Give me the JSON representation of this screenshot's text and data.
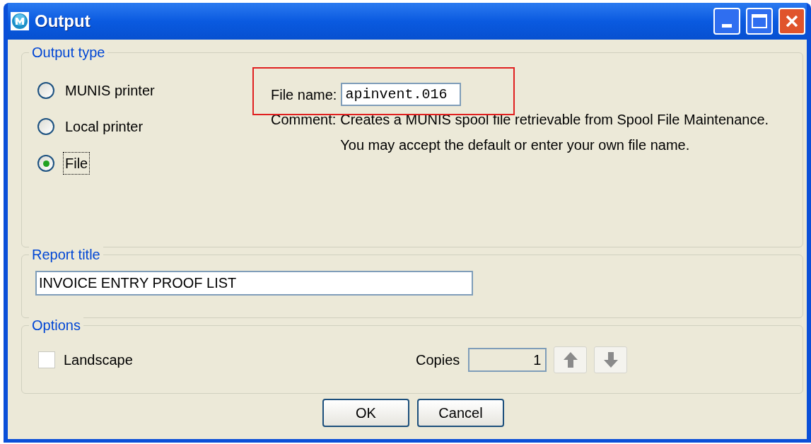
{
  "window": {
    "title": "Output"
  },
  "output_type": {
    "label": "Output type",
    "options": [
      {
        "label": "MUNIS printer",
        "selected": false
      },
      {
        "label": "Local printer",
        "selected": false
      },
      {
        "label": "File",
        "selected": true
      }
    ],
    "file_name": {
      "label": "File name:",
      "value": "apinvent.016"
    },
    "comment": {
      "label": "Comment:",
      "lines": [
        "Creates a MUNIS spool file retrievable from Spool File Maintenance.",
        "You may accept the default or enter your own file name."
      ]
    }
  },
  "report_title": {
    "label": "Report title",
    "value": "INVOICE ENTRY PROOF LIST"
  },
  "options": {
    "label": "Options",
    "landscape": {
      "label": "Landscape",
      "checked": false
    },
    "copies": {
      "label": "Copies",
      "value": "1"
    }
  },
  "buttons": [
    "OK",
    "Cancel"
  ]
}
